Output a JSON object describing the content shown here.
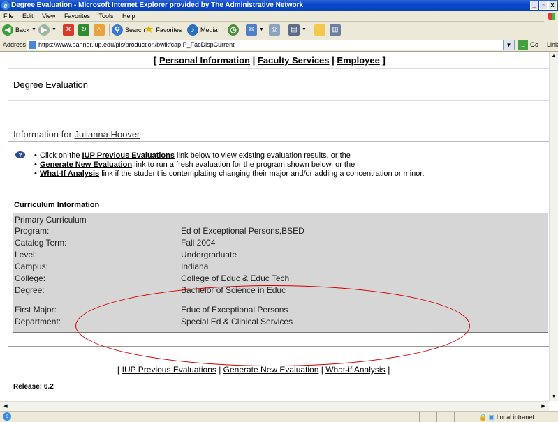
{
  "window": {
    "title": "Degree Evaluation - Microsoft Internet Explorer provided by The Administrative Network",
    "buttons": [
      "_",
      "▫",
      "x"
    ]
  },
  "menubar": {
    "items": [
      "File",
      "Edit",
      "View",
      "Favorites",
      "Tools",
      "Help"
    ]
  },
  "toolbar": {
    "back": "Back",
    "search": "Search",
    "favorites": "Favorites",
    "media": "Media"
  },
  "address": {
    "label": "Address",
    "url": "https://www.banner.iup.edu/pls/production/bwlkfcap.P_FacDispCurrent",
    "go": "Go",
    "links": "Link"
  },
  "page": {
    "top_nav": {
      "open": "[",
      "personal": "Personal Information",
      "sep1": "|",
      "faculty": "Faculty Services",
      "sep2": "|",
      "employee": "Employee",
      "close": "]"
    },
    "title": "Degree Evaluation",
    "info_prefix": "Information for ",
    "student_name": "Julianna Hoover",
    "bullets": [
      {
        "pre": "Click on the ",
        "link": "IUP Previous Evaluations",
        "post": " link below to view existing evaluation results, or the"
      },
      {
        "pre": "",
        "link": "Generate New Evaluation",
        "post": " link to run a fresh evaluation for the program shown below, or the"
      },
      {
        "pre": "",
        "link": "What-If Analysis",
        "post": " link if the student is contemplating changing their major and/or adding a concentration or minor."
      }
    ],
    "curriculum_title": "Curriculum Information",
    "curriculum": {
      "header": "Primary Curriculum",
      "rows": [
        {
          "k": "Program:",
          "v": "Ed of Exceptional Persons,BSED"
        },
        {
          "k": "Catalog Term:",
          "v": "Fall 2004"
        },
        {
          "k": "Level:",
          "v": "Undergraduate"
        },
        {
          "k": "Campus:",
          "v": "Indiana"
        },
        {
          "k": "College:",
          "v": "College of Educ & Educ Tech"
        },
        {
          "k": "Degree:",
          "v": "Bachelor of Science in Educ"
        },
        {
          "k": "First Major:",
          "v": "Educ of Exceptional Persons"
        },
        {
          "k": "Department:",
          "v": "Special Ed & Clinical Services"
        }
      ]
    },
    "bottom_links": {
      "open": "[ ",
      "previous": "IUP Previous Evaluations",
      "sep1": " | ",
      "generate": "Generate New Evaluation",
      "sep2": " | ",
      "whatif": "What-if Analysis",
      "close": " ]"
    },
    "release": "Release: 6.2"
  },
  "status": {
    "zone": "Local intranet"
  },
  "colors": {
    "titlebar": "#0a48c8",
    "highlight": "#d40000",
    "panel": "#d6d6d6"
  }
}
